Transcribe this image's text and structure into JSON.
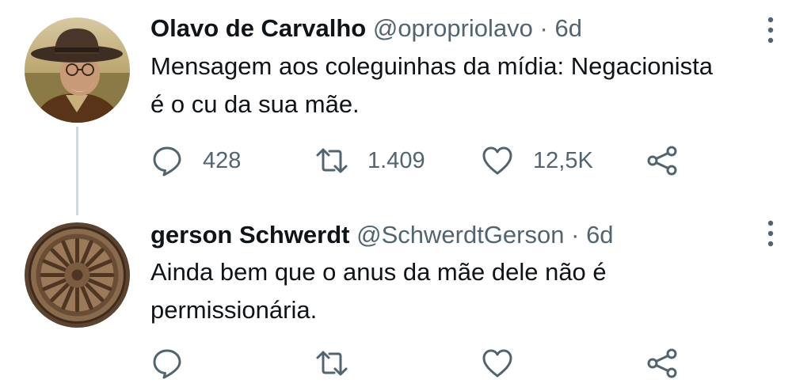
{
  "tweets": [
    {
      "display_name": "Olavo de Carvalho",
      "handle": "@opropriolavo",
      "separator": "·",
      "time": "6d",
      "text_lines": [
        "Mensagem aos coleguinhas da mídia: Negacionista",
        "é o cu da sua mãe."
      ],
      "avatar_icon": "man-in-cowboy-hat-photo",
      "actions": {
        "replies": "428",
        "retweets": "1.409",
        "likes": "12,5K"
      }
    },
    {
      "display_name": "gerson Schwerdt",
      "handle": "@SchwerdtGerson",
      "separator": "·",
      "time": "6d",
      "text_lines": [
        "Ainda bem que o anus da mãe dele não é",
        "permissionária."
      ],
      "avatar_icon": "stone-wheel-carving-photo",
      "actions": {
        "replies": "",
        "retweets": "",
        "likes": ""
      }
    }
  ],
  "icons": {
    "reply": "reply-icon",
    "retweet": "retweet-icon",
    "like": "heart-icon",
    "share": "share-icon",
    "more": "more-vertical-icon"
  },
  "colors": {
    "text_primary": "#0f1419",
    "text_secondary": "#536471",
    "thread_line": "#cfd9de"
  }
}
